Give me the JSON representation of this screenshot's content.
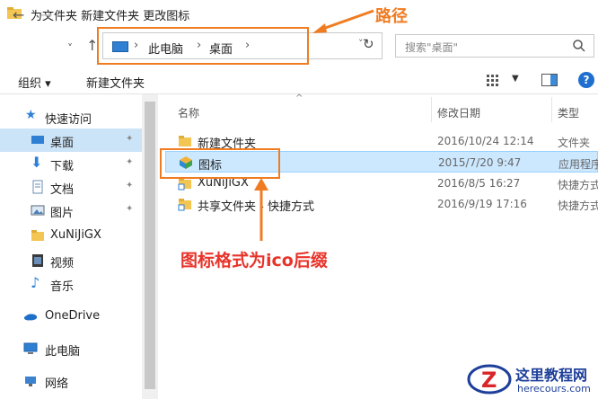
{
  "window": {
    "title": "为文件夹 新建文件夹 更改图标"
  },
  "nav": {
    "back": "←",
    "forward": "→",
    "recent": "˅",
    "up": "↑"
  },
  "address": {
    "segments": [
      "此电脑",
      "桌面"
    ],
    "separator": "›"
  },
  "search": {
    "placeholder": "搜索\"桌面\""
  },
  "toolbar": {
    "organize": "组织 ▾",
    "new_folder": "新建文件夹"
  },
  "sidebar": {
    "items": [
      {
        "label": "快速访问",
        "icon": "star-icon"
      },
      {
        "label": "桌面",
        "icon": "desktop-icon",
        "pinned": true,
        "selected": true
      },
      {
        "label": "下载",
        "icon": "download-icon",
        "pinned": true
      },
      {
        "label": "文档",
        "icon": "document-icon",
        "pinned": true
      },
      {
        "label": "图片",
        "icon": "picture-icon",
        "pinned": true
      },
      {
        "label": "XuNiJiGX",
        "icon": "folder-icon"
      },
      {
        "label": "视频",
        "icon": "video-icon"
      },
      {
        "label": "音乐",
        "icon": "music-icon"
      },
      {
        "label": "OneDrive",
        "icon": "cloud-icon"
      },
      {
        "label": "此电脑",
        "icon": "computer-icon"
      },
      {
        "label": "网络",
        "icon": "network-icon"
      }
    ]
  },
  "columns": {
    "name": "名称",
    "modified": "修改日期",
    "type": "类型"
  },
  "files": [
    {
      "name": "新建文件夹",
      "date": "2016/10/24 12:14",
      "type": "文件夹",
      "icon": "folder-icon"
    },
    {
      "name": "图标",
      "date": "2015/7/20 9:47",
      "type": "应用程序",
      "icon": "app-icon",
      "selected": true
    },
    {
      "name": "XuNiJiGX",
      "date": "2016/8/5 16:27",
      "type": "快捷方式",
      "icon": "shortcut-folder-icon"
    },
    {
      "name": "共享文件夹 - 快捷方式",
      "date": "2016/9/19 17:16",
      "type": "快捷方式",
      "icon": "shortcut-folder-icon"
    }
  ],
  "annotations": {
    "path_label": "路径",
    "icon_format": "图标格式为ico后缀"
  },
  "watermark": {
    "title": "这里教程网",
    "url": "herecours.com"
  },
  "colors": {
    "annotation": "#f07c22",
    "annotation_text_red": "#e8332a",
    "selection": "#cce8ff",
    "accent": "#1e6fd0"
  }
}
